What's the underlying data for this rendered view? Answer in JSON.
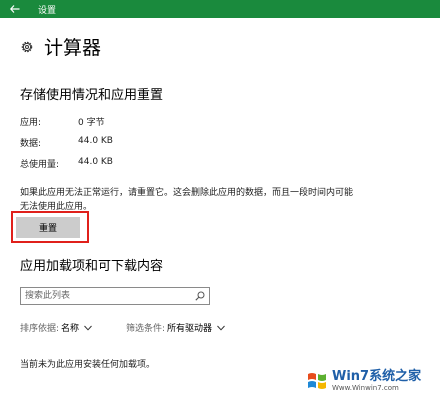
{
  "window": {
    "title": "设置"
  },
  "page": {
    "title": "计算器"
  },
  "storage": {
    "heading": "存储使用情况和应用重置",
    "rows": [
      {
        "label": "应用:",
        "value": "0 字节"
      },
      {
        "label": "数据:",
        "value": "44.0 KB"
      },
      {
        "label": "总使用量:",
        "value": "44.0 KB"
      }
    ],
    "description": "如果此应用无法正常运行，请重置它。这会删除此应用的数据，而且一段时间内可能无法使用此应用。",
    "reset_label": "重置"
  },
  "addons": {
    "heading": "应用加载项和可下载内容",
    "search_placeholder": "搜索此列表",
    "sort_label": "排序依据:",
    "sort_value": "名称",
    "filter_label": "筛选条件:",
    "filter_value": "所有驱动器",
    "empty_message": "当前未为此应用安装任何加载项。"
  },
  "watermark": {
    "title": "Win7系统之家",
    "url": "Www.Winwin7.com"
  },
  "colors": {
    "titlebar": "#1a8a3d",
    "highlight": "#e0201b",
    "button": "#cccccc"
  }
}
